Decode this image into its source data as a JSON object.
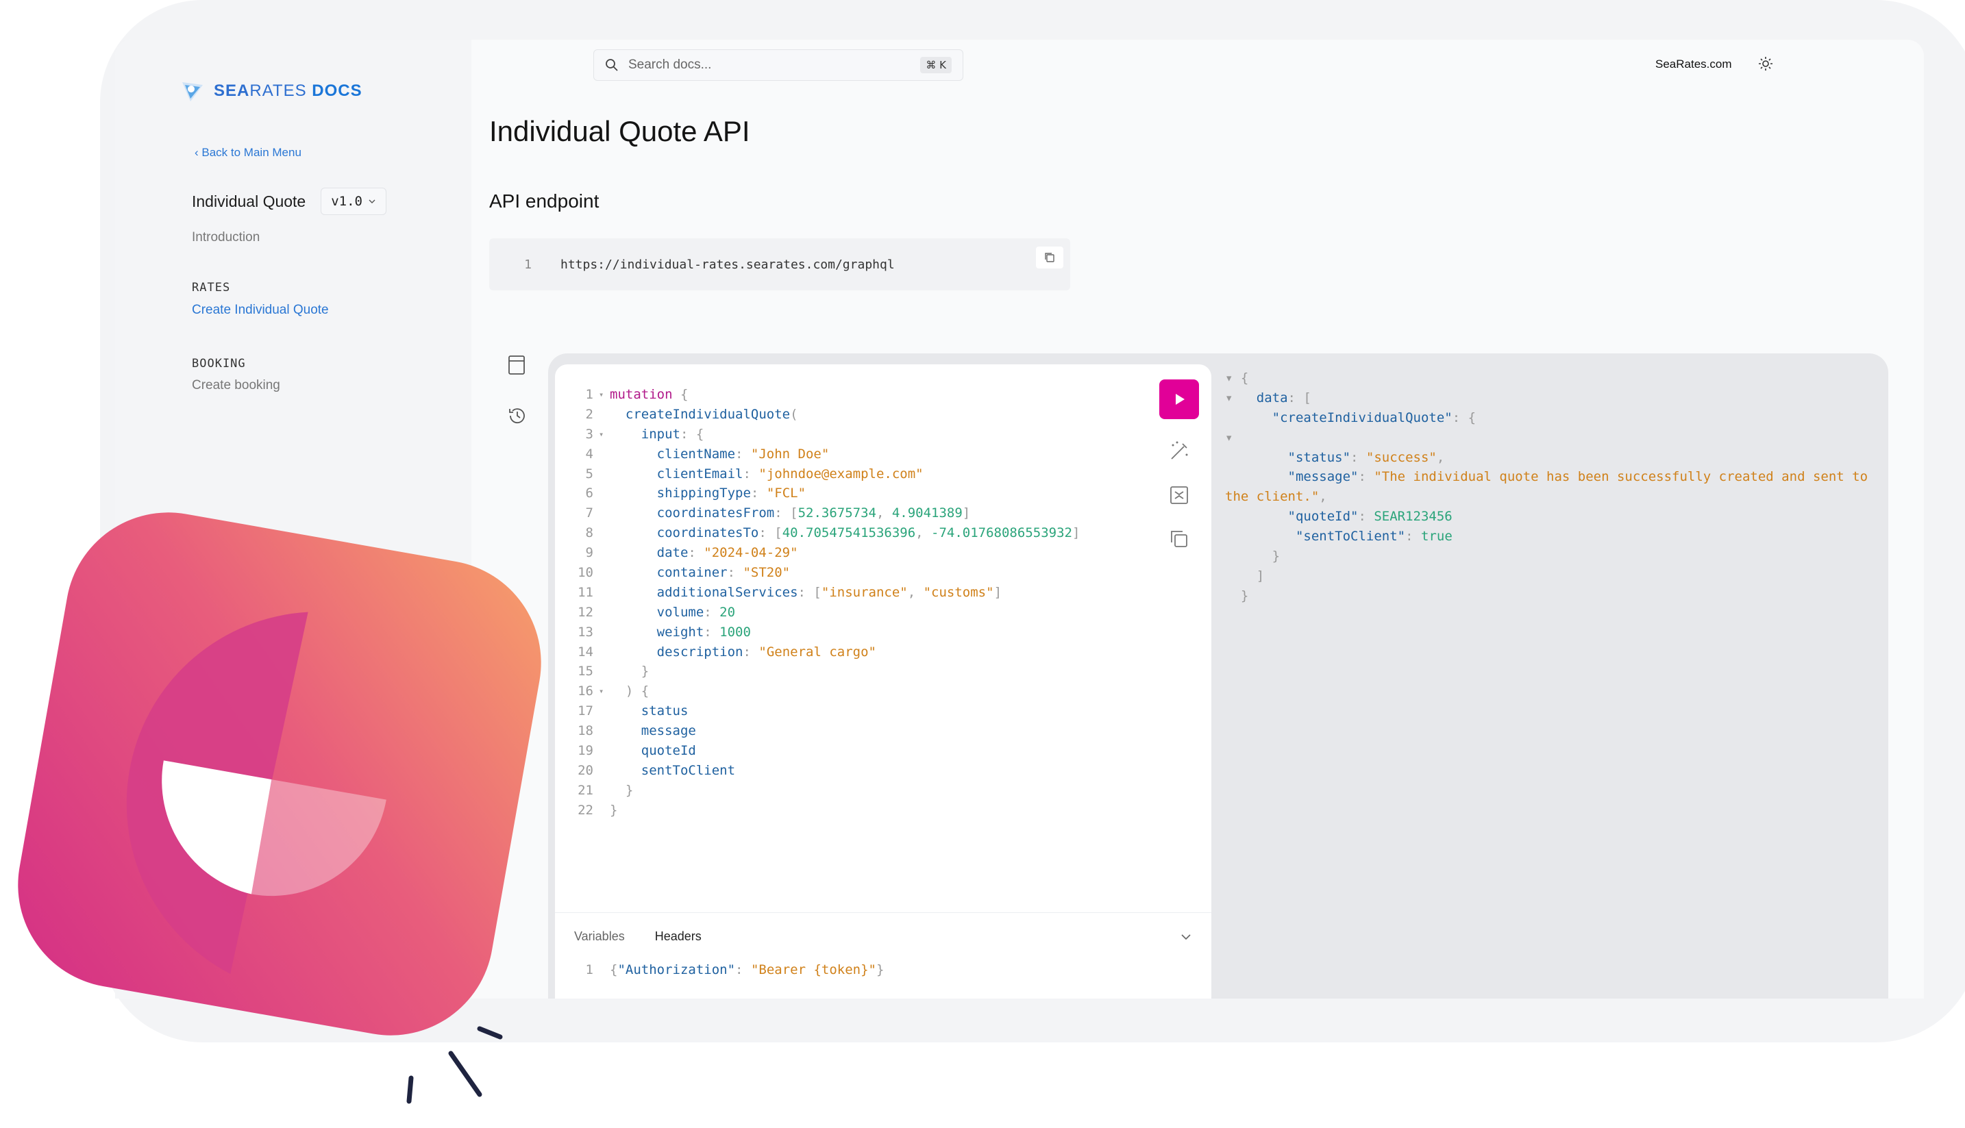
{
  "brand": {
    "logo_icon": "searates-logo-icon",
    "name_part1": "SEA",
    "name_part2": "RATES",
    "name_part3": "DOCS"
  },
  "sidebar": {
    "back_link": "‹ Back to Main Menu",
    "product_title": "Individual Quote",
    "version": "v1.0",
    "introduction": "Introduction",
    "sections": [
      {
        "heading": "RATES",
        "link": "Create Individual Quote",
        "active": true
      },
      {
        "heading": "BOOKING",
        "link": "Create booking",
        "active": false
      }
    ]
  },
  "topbar": {
    "search_placeholder": "Search docs...",
    "shortcut": "⌘ K",
    "site_link": "SeaRates.com"
  },
  "page": {
    "title": "Individual Quote API",
    "section_title": "API endpoint"
  },
  "endpoint": {
    "line": "1",
    "url": "https://individual-rates.searates.com/graphql"
  },
  "editor": {
    "lines": [
      {
        "n": "1",
        "fold": "▾",
        "html_tokens": [
          [
            "kw",
            "mutation"
          ],
          [
            "punct",
            " {"
          ]
        ]
      },
      {
        "n": "2",
        "fold": "",
        "html_tokens": [
          [
            "plain",
            "  "
          ],
          [
            "field",
            "createIndividualQuote"
          ],
          [
            "punct",
            "("
          ]
        ]
      },
      {
        "n": "3",
        "fold": "▾",
        "html_tokens": [
          [
            "plain",
            "    "
          ],
          [
            "field",
            "input"
          ],
          [
            "punct",
            ": {"
          ]
        ]
      },
      {
        "n": "4",
        "fold": "",
        "html_tokens": [
          [
            "plain",
            "      "
          ],
          [
            "field",
            "clientName"
          ],
          [
            "punct",
            ": "
          ],
          [
            "str",
            "\"John Doe\""
          ]
        ]
      },
      {
        "n": "5",
        "fold": "",
        "html_tokens": [
          [
            "plain",
            "      "
          ],
          [
            "field",
            "clientEmail"
          ],
          [
            "punct",
            ": "
          ],
          [
            "str",
            "\"johndoe@example.com\""
          ]
        ]
      },
      {
        "n": "6",
        "fold": "",
        "html_tokens": [
          [
            "plain",
            "      "
          ],
          [
            "field",
            "shippingType"
          ],
          [
            "punct",
            ": "
          ],
          [
            "str",
            "\"FCL\""
          ]
        ]
      },
      {
        "n": "7",
        "fold": "",
        "html_tokens": [
          [
            "plain",
            "      "
          ],
          [
            "field",
            "coordinatesFrom"
          ],
          [
            "punct",
            ": ["
          ],
          [
            "num",
            "52.3675734"
          ],
          [
            "punct",
            ", "
          ],
          [
            "num",
            "4.9041389"
          ],
          [
            "punct",
            "]"
          ]
        ]
      },
      {
        "n": "8",
        "fold": "",
        "html_tokens": [
          [
            "plain",
            "      "
          ],
          [
            "field",
            "coordinatesTo"
          ],
          [
            "punct",
            ": ["
          ],
          [
            "num",
            "40.70547541536396"
          ],
          [
            "punct",
            ", "
          ],
          [
            "num",
            "-74.01768086553932"
          ],
          [
            "punct",
            "]"
          ]
        ]
      },
      {
        "n": "9",
        "fold": "",
        "html_tokens": [
          [
            "plain",
            "      "
          ],
          [
            "field",
            "date"
          ],
          [
            "punct",
            ": "
          ],
          [
            "str",
            "\"2024-04-29\""
          ]
        ]
      },
      {
        "n": "10",
        "fold": "",
        "html_tokens": [
          [
            "plain",
            "      "
          ],
          [
            "field",
            "container"
          ],
          [
            "punct",
            ": "
          ],
          [
            "str",
            "\"ST20\""
          ]
        ]
      },
      {
        "n": "11",
        "fold": "",
        "html_tokens": [
          [
            "plain",
            "      "
          ],
          [
            "field",
            "additionalServices"
          ],
          [
            "punct",
            ": ["
          ],
          [
            "str",
            "\"insurance\""
          ],
          [
            "punct",
            ", "
          ],
          [
            "str",
            "\"customs\""
          ],
          [
            "punct",
            "]"
          ]
        ]
      },
      {
        "n": "12",
        "fold": "",
        "html_tokens": [
          [
            "plain",
            "      "
          ],
          [
            "field",
            "volume"
          ],
          [
            "punct",
            ": "
          ],
          [
            "num",
            "20"
          ]
        ]
      },
      {
        "n": "13",
        "fold": "",
        "html_tokens": [
          [
            "plain",
            "      "
          ],
          [
            "field",
            "weight"
          ],
          [
            "punct",
            ": "
          ],
          [
            "num",
            "1000"
          ]
        ]
      },
      {
        "n": "14",
        "fold": "",
        "html_tokens": [
          [
            "plain",
            "      "
          ],
          [
            "field",
            "description"
          ],
          [
            "punct",
            ": "
          ],
          [
            "str",
            "\"General cargo\""
          ]
        ]
      },
      {
        "n": "15",
        "fold": "",
        "html_tokens": [
          [
            "punct",
            "    }"
          ]
        ]
      },
      {
        "n": "16",
        "fold": "▾",
        "html_tokens": [
          [
            "punct",
            "  ) {"
          ]
        ]
      },
      {
        "n": "17",
        "fold": "",
        "html_tokens": [
          [
            "plain",
            "    "
          ],
          [
            "field",
            "status"
          ]
        ]
      },
      {
        "n": "18",
        "fold": "",
        "html_tokens": [
          [
            "plain",
            "    "
          ],
          [
            "field",
            "message"
          ]
        ]
      },
      {
        "n": "19",
        "fold": "",
        "html_tokens": [
          [
            "plain",
            "    "
          ],
          [
            "field",
            "quoteId"
          ]
        ]
      },
      {
        "n": "20",
        "fold": "",
        "html_tokens": [
          [
            "plain",
            "    "
          ],
          [
            "field",
            "sentToClient"
          ]
        ]
      },
      {
        "n": "21",
        "fold": "",
        "html_tokens": [
          [
            "punct",
            "  }"
          ]
        ]
      },
      {
        "n": "22",
        "fold": "",
        "html_tokens": [
          [
            "punct",
            "}"
          ]
        ]
      }
    ],
    "tabs": {
      "variables": "Variables",
      "headers": "Headers"
    },
    "headers_line": {
      "n": "1",
      "tokens": [
        [
          "punct",
          "{"
        ],
        [
          "field",
          "\"Authorization\""
        ],
        [
          "punct",
          ": "
        ],
        [
          "str",
          "\"Bearer {token}\""
        ],
        [
          "punct",
          "}"
        ]
      ]
    }
  },
  "result": {
    "lines": [
      [
        [
          "punct",
          "▾ {"
        ]
      ],
      [
        [
          "punct",
          "▾   "
        ],
        [
          "key",
          "data"
        ],
        [
          "punct",
          ": ["
        ]
      ],
      [
        [
          "plain",
          "      "
        ],
        [
          "key",
          "\"createIndividualQuote\""
        ],
        [
          "punct",
          ": {"
        ]
      ],
      [
        [
          "punct",
          "▾"
        ]
      ],
      [
        [
          "plain",
          "        "
        ],
        [
          "key",
          "\"status\""
        ],
        [
          "punct",
          ": "
        ],
        [
          "str",
          "\"success\""
        ],
        [
          "punct",
          ","
        ]
      ],
      [
        [
          "plain",
          "        "
        ],
        [
          "key",
          "\"message\""
        ],
        [
          "punct",
          ": "
        ],
        [
          "str",
          "\"The individual quote has been successfully created and sent to"
        ]
      ],
      [
        [
          "str",
          "the client.\""
        ],
        [
          "punct",
          ","
        ]
      ],
      [
        [
          "plain",
          "        "
        ],
        [
          "key",
          "\"quoteId\""
        ],
        [
          "punct",
          ": "
        ],
        [
          "num",
          "SEAR123456"
        ]
      ],
      [
        [
          "plain",
          "         "
        ],
        [
          "key",
          "\"sentToClient\""
        ],
        [
          "punct",
          ": "
        ],
        [
          "num",
          "true"
        ]
      ],
      [
        [
          "punct",
          "      }"
        ]
      ],
      [
        [
          "punct",
          "    ]"
        ]
      ],
      [
        [
          "punct",
          "  }"
        ]
      ]
    ]
  },
  "colors": {
    "accent": "#e10098",
    "link": "#2a77d4",
    "brand": "#1b76d8"
  }
}
